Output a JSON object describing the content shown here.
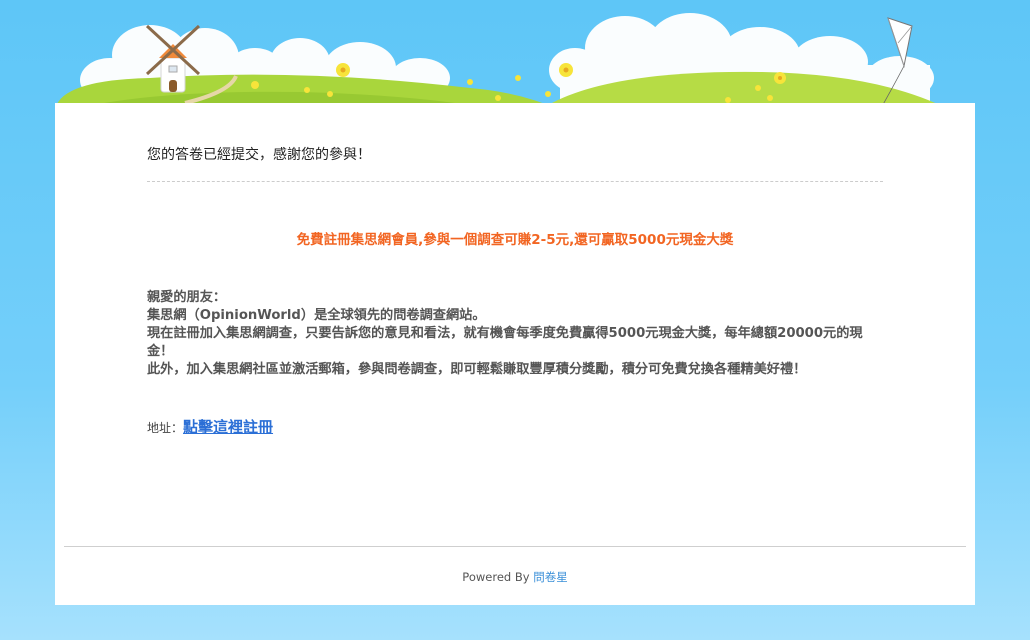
{
  "confirmation": {
    "message": "您的答卷已經提交，感謝您的參與！"
  },
  "promo": {
    "headline": "免費註冊集思網會員,參與一個調查可賺2-5元,還可贏取5000元現金大獎"
  },
  "body": {
    "greeting": "親愛的朋友：",
    "line1": "集思網（OpinionWorld）是全球領先的問卷調查網站。",
    "line2": "現在註冊加入集思網調查，只要告訴您的意見和看法，就有機會每季度免費贏得5000元現金大獎，每年總額20000元的現金！",
    "line3": "此外，加入集思網社區並激活郵箱，參與問卷調查，即可輕鬆賺取豐厚積分獎勵，積分可免費兌換各種精美好禮！"
  },
  "address": {
    "label": "地址：",
    "link_text": "點擊這裡註冊"
  },
  "footer": {
    "powered_by": "Powered By",
    "brand_link": "問卷星"
  },
  "colors": {
    "sky": "#5ec6f7",
    "grass": "#a9d63c",
    "promo_orange": "#f26522",
    "link_blue": "#2b6fd6"
  }
}
